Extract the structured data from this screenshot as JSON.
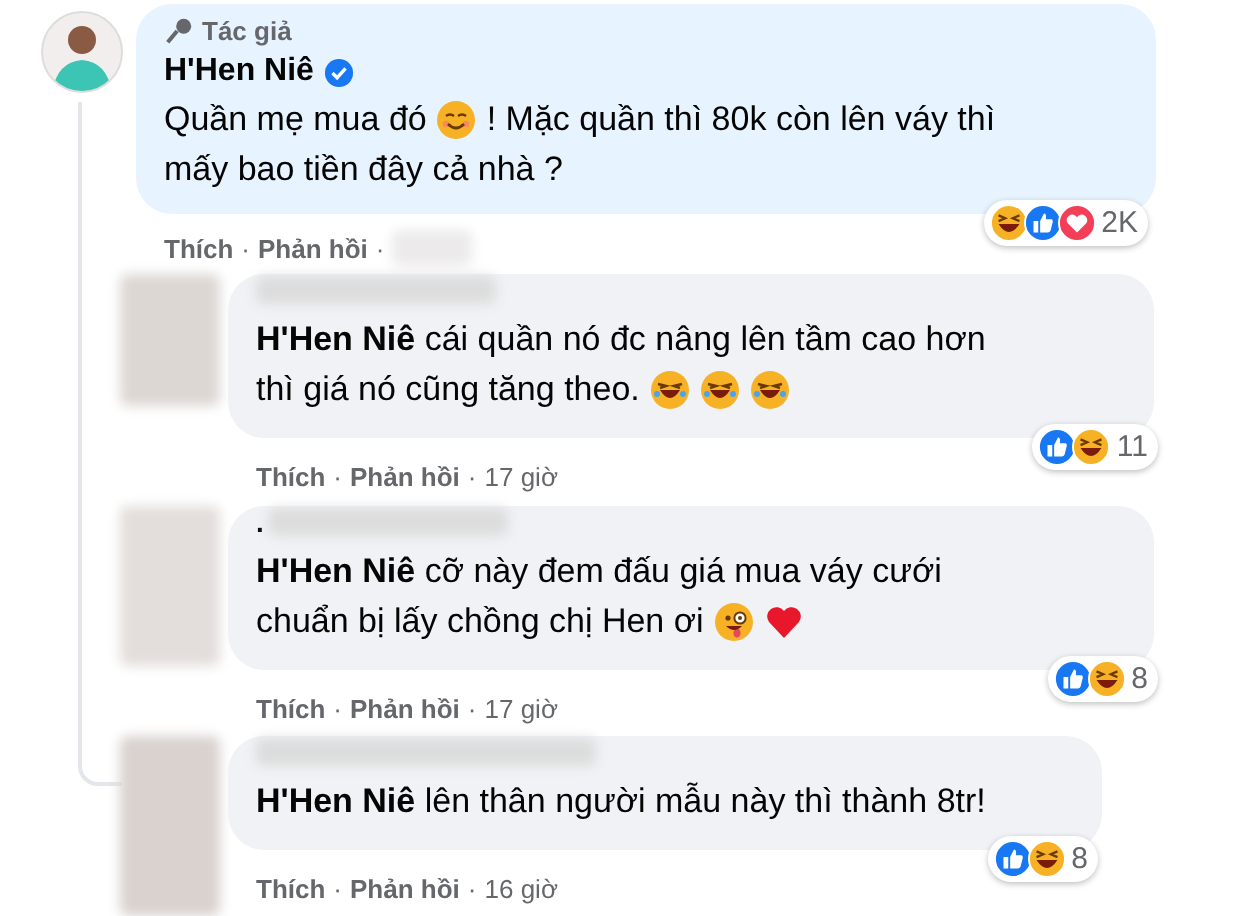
{
  "comment": {
    "badge": "Tác giả",
    "author": "H'Hen Niê",
    "verified": true,
    "lines": [
      [
        {
          "kind": "text",
          "text": "Quần mẹ mua đó"
        },
        {
          "kind": "smiling"
        },
        {
          "kind": "text",
          "text": "! Mặc quần thì 80k còn lên váy thì"
        }
      ],
      [
        {
          "kind": "text",
          "text": "mấy bao tiền đây cả nhà ?"
        }
      ]
    ],
    "reactions": [
      {
        "kind": "haha"
      },
      {
        "kind": "like"
      },
      {
        "kind": "love"
      }
    ],
    "reaction_count": "2K",
    "actions": [
      "Thích",
      "Phản hồi"
    ],
    "separator": "·"
  },
  "replies": [
    {
      "lines": [
        [
          {
            "kind": "text",
            "text": "**H'Hen Niê** cái quần nó đc nâng lên tầm cao hơn"
          }
        ],
        [
          {
            "kind": "text",
            "text": "thì giá nó cũng tăng theo."
          },
          {
            "kind": "rofl"
          },
          {
            "kind": "rofl"
          },
          {
            "kind": "rofl"
          }
        ]
      ],
      "reactions": [
        {
          "kind": "like"
        },
        {
          "kind": "haha"
        }
      ],
      "reaction_count": "11",
      "actions": [
        "Thích",
        "Phản hồi"
      ],
      "separator": "·",
      "time": "17 giờ"
    },
    {
      "name": ".",
      "lines": [
        [
          {
            "kind": "text",
            "text": "**H'Hen Niê** cỡ này đem đấu giá mua váy cưới"
          }
        ],
        [
          {
            "kind": "text",
            "text": "chuẩn bị lấy chồng chị Hen ơi"
          },
          {
            "kind": "wink"
          },
          {
            "kind": "heart"
          }
        ]
      ],
      "reactions": [
        {
          "kind": "like"
        },
        {
          "kind": "haha"
        }
      ],
      "reaction_count": "8",
      "actions": [
        "Thích",
        "Phản hồi"
      ],
      "separator": "·",
      "time": "17 giờ"
    },
    {
      "lines": [
        [
          {
            "kind": "text",
            "text": "**H'Hen Niê** lên thân người mẫu này thì thành 8tr!"
          }
        ]
      ],
      "reactions": [
        {
          "kind": "like"
        },
        {
          "kind": "haha"
        }
      ],
      "reaction_count": "8",
      "actions": [
        "Thích",
        "Phản hồi"
      ],
      "separator": "·",
      "time": "16 giờ"
    }
  ]
}
